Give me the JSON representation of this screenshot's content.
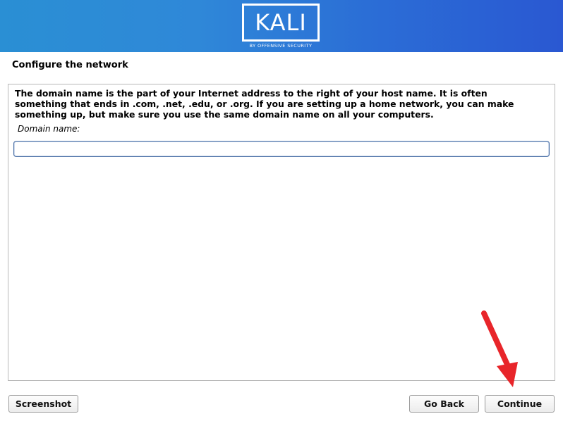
{
  "header": {
    "logo_text": "KALI",
    "logo_subtitle": "BY OFFENSIVE SECURITY"
  },
  "page": {
    "title": "Configure the network"
  },
  "main": {
    "description": "The domain name is the part of your Internet address to the right of your host name.  It is often\nsomething that ends in .com, .net, .edu, or .org.  If you are setting up a home network, you can make\nsomething up, but make sure you use the same domain name on all your computers.",
    "field_label": "Domain name:",
    "domain_value": ""
  },
  "footer": {
    "screenshot_label": "Screenshot",
    "back_label": "Go Back",
    "continue_label": "Continue"
  },
  "colors": {
    "banner_start": "#2a8fd4",
    "banner_end": "#2a58d2",
    "annotation_arrow": "#e8252a"
  }
}
